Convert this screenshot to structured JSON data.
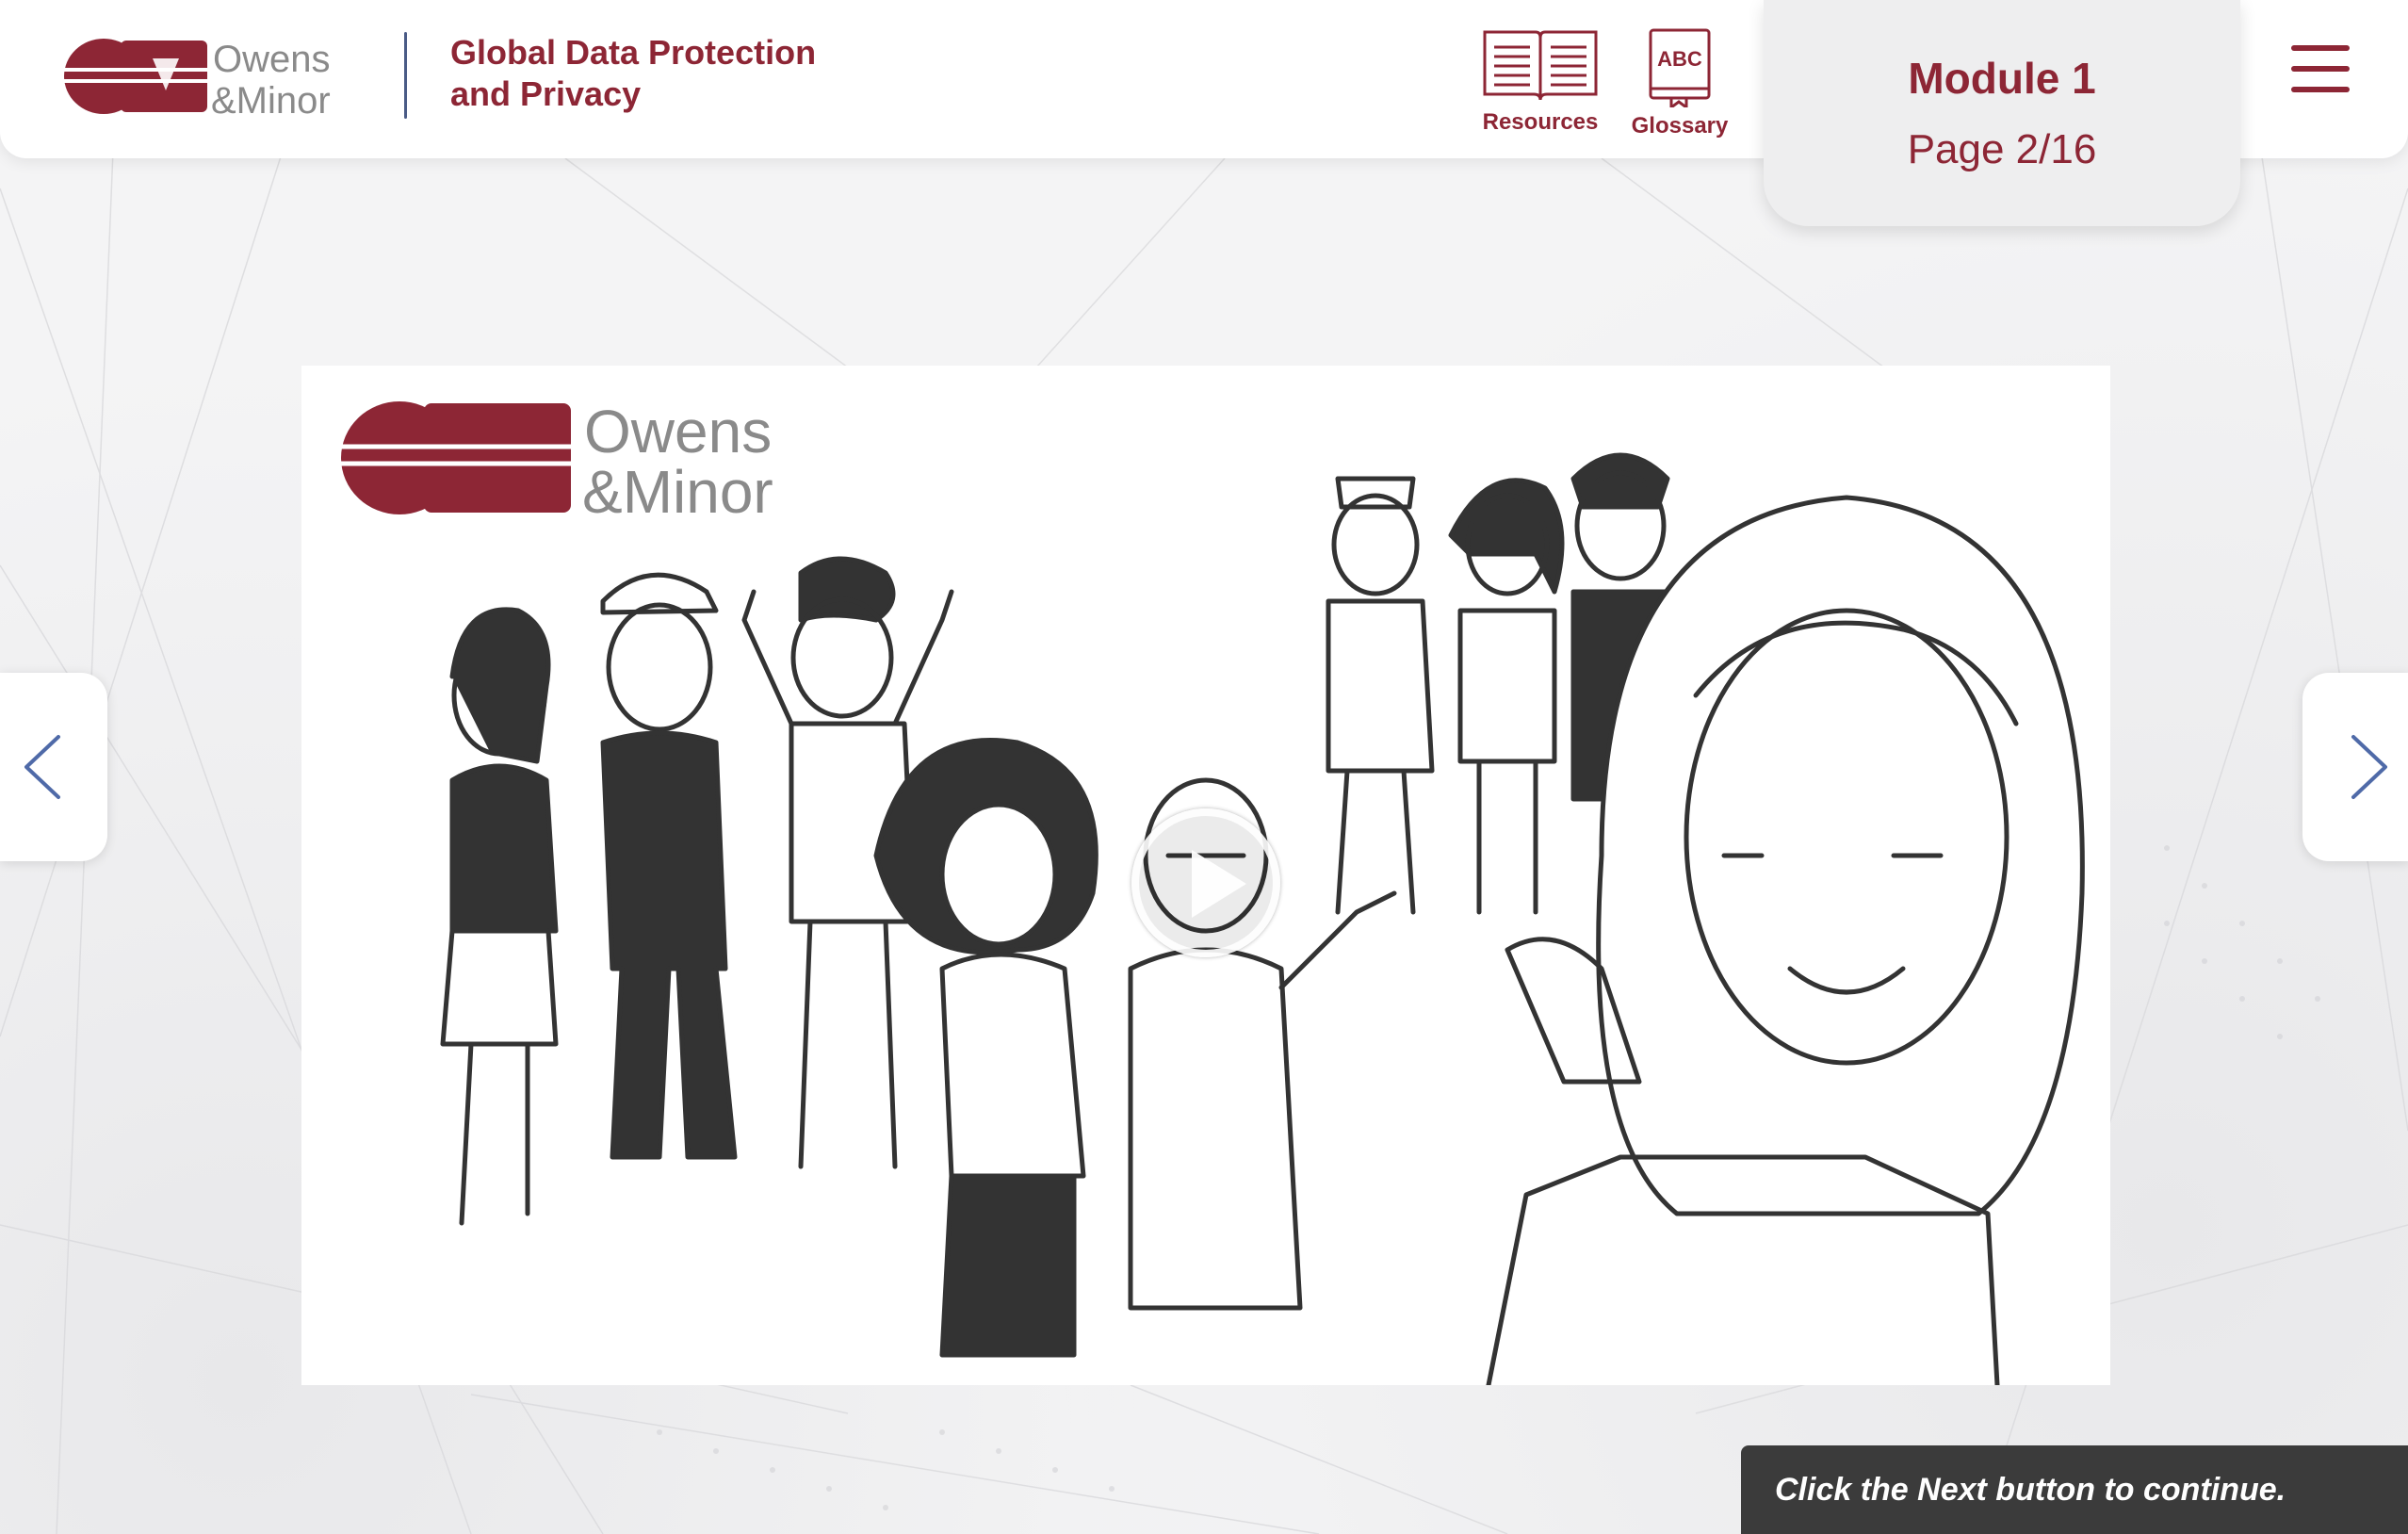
{
  "header": {
    "logo": {
      "line1": "Owens",
      "line2": "&Minor",
      "mark": "OM"
    },
    "course_title_line1": "Global Data Protection",
    "course_title_line2": "and Privacy",
    "tools": [
      {
        "label": "Resources",
        "icon": "book-icon"
      },
      {
        "label": "Glossary",
        "icon": "glossary-icon",
        "icon_text": "ABC"
      }
    ],
    "module": {
      "title": "Module 1",
      "page": "Page 2/16"
    },
    "menu_icon": "hamburger-icon"
  },
  "video": {
    "logo": {
      "line1": "Owens",
      "line2": "&Minor",
      "mark": "OM"
    },
    "play_icon": "play-icon"
  },
  "navigation": {
    "prev_icon": "chevron-left-icon",
    "next_icon": "chevron-right-icon"
  },
  "footer": {
    "instruction": "Click the Next button to continue."
  },
  "colors": {
    "brand": "#8d2635",
    "divider": "#4a5b86",
    "nav_arrow": "#4f6aa8",
    "instruction_bg": "#3b3b3b"
  }
}
